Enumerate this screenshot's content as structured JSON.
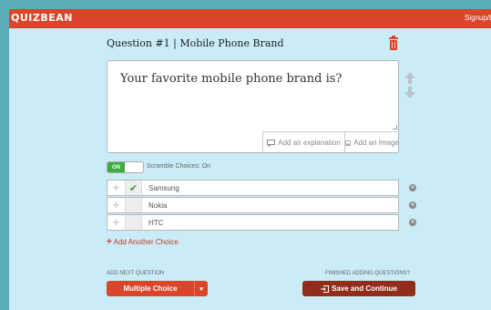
{
  "header": {
    "logo_text": "QUIZBEAN",
    "signup_label": "Signup/Lo"
  },
  "question": {
    "title": "Question #1 | Mobile Phone Brand",
    "text": "Your favorite mobile phone brand is?",
    "add_explanation_label": "Add an explanation",
    "add_image_label": "Add an Image"
  },
  "scramble": {
    "toggle_label": "ON",
    "status_text": "Scramble Choices: On"
  },
  "choices": [
    {
      "label": "Samsung",
      "correct": true
    },
    {
      "label": "Nokia",
      "correct": false
    },
    {
      "label": "HTC",
      "correct": false
    }
  ],
  "add_choice_label": "Add Another Choice",
  "footer": {
    "next_question_label": "ADD NEXT QUESTION",
    "finished_label": "FINISHED ADDING QUESTIONS?",
    "question_type_value": "Multiple Choice",
    "save_label": "Save and Continue"
  },
  "colors": {
    "header": "#d9462a",
    "background": "#c9ecf7",
    "frame_border": "#5aaeb8",
    "toggle_on": "#3dac3d",
    "save_button": "#922d1b"
  },
  "icons": [
    "trash-icon",
    "arrow-up-icon",
    "arrow-down-icon",
    "comment-icon",
    "image-icon",
    "drag-handle-icon",
    "check-icon",
    "remove-icon",
    "plus-icon",
    "caret-down-icon",
    "sign-in-icon"
  ]
}
